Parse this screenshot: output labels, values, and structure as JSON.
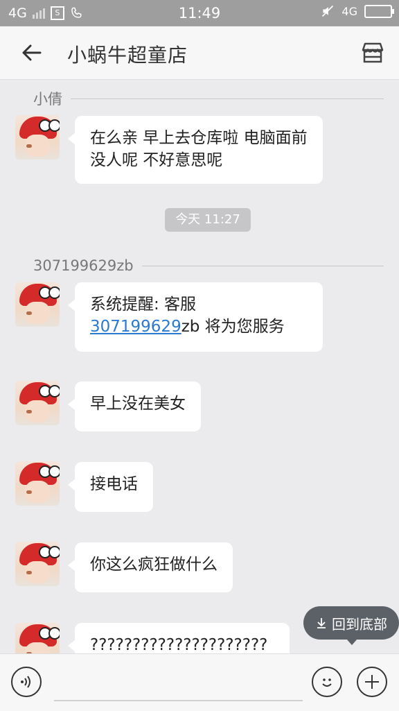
{
  "status_bar": {
    "network_left": "4G",
    "time": "11:49",
    "network_right": "4G",
    "icons": [
      "signal-icon",
      "sim-s-icon",
      "phone-icon",
      "mute-icon",
      "battery-icon"
    ]
  },
  "header": {
    "title": "小蜗牛超童店",
    "back_icon": "arrow-left-icon",
    "shop_icon": "store-icon"
  },
  "chat": {
    "sections": [
      {
        "sender": "小倩"
      },
      {
        "sender": "307199629zb"
      }
    ],
    "time_divider": "今天 11:27",
    "messages": [
      {
        "text": "在么亲 早上去仓库啦 电脑面前没人呢 不好意思呢"
      },
      {
        "prefix": "系统提醒: 客服",
        "link": "307199629",
        "suffix": "zb 将为您服务"
      },
      {
        "text": "早上没在美女"
      },
      {
        "text": "接电话"
      },
      {
        "text": "你这么疯狂做什么"
      },
      {
        "text": "?????????????????????"
      }
    ]
  },
  "scroll_to_bottom": {
    "label": "回到底部",
    "icon": "arrow-down-icon"
  },
  "input_bar": {
    "value": "",
    "voice_icon": "voice-icon",
    "emoji_icon": "emoji-icon",
    "plus_icon": "plus-icon"
  },
  "colors": {
    "link": "#2a7ad2",
    "statusbar": "#9e9e9e",
    "background": "#ebebed"
  }
}
